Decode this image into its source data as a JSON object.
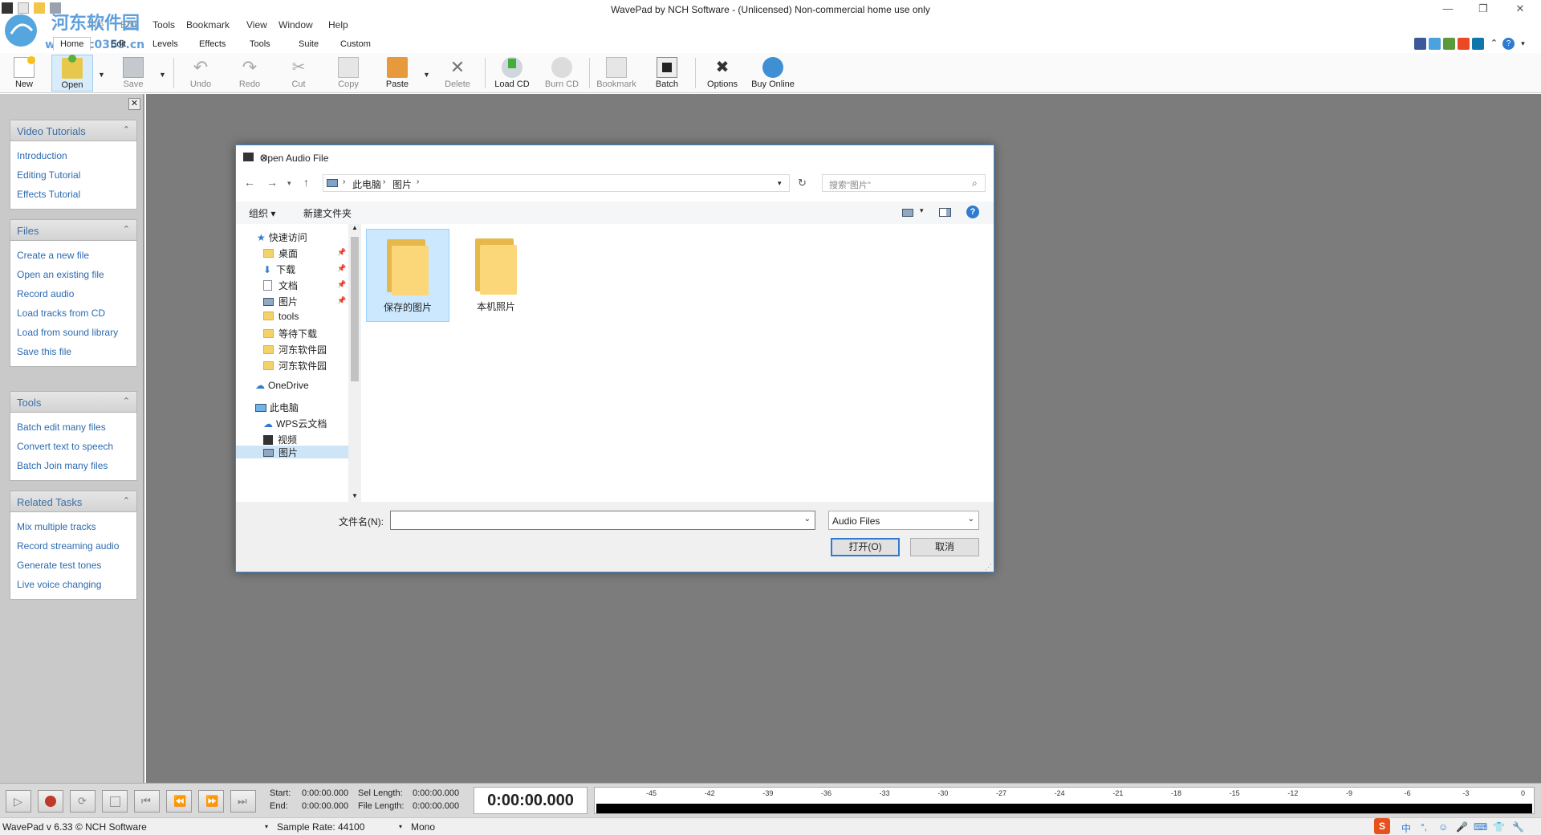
{
  "window": {
    "title": "WavePad by NCH Software - (Unlicensed) Non-commercial home use only",
    "minimize": "—",
    "restore": "❐",
    "close": "✕"
  },
  "menu": [
    "File",
    "Edit",
    "Tools",
    "Bookmark",
    "View",
    "Window",
    "Help"
  ],
  "watermark": {
    "line1": "河东软件园",
    "line2": "www.pc0359.cn"
  },
  "tabs": {
    "home": "Home",
    "edit": "Edit",
    "levels": "Levels",
    "effects": "Effects",
    "tools": "Tools",
    "suite": "Suite",
    "custom": "Custom"
  },
  "toolbar": {
    "new": "New",
    "open": "Open",
    "save": "Save",
    "undo": "Undo",
    "redo": "Redo",
    "cut": "Cut",
    "copy": "Copy",
    "paste": "Paste",
    "delete": "Delete",
    "load_cd": "Load CD",
    "burn_cd": "Burn CD",
    "bookmark": "Bookmark",
    "batch": "Batch",
    "options": "Options",
    "buy_online": "Buy Online"
  },
  "left_panels": {
    "video_tutorials": {
      "title": "Video Tutorials",
      "items": [
        "Introduction",
        "Editing Tutorial",
        "Effects Tutorial"
      ]
    },
    "files": {
      "title": "Files",
      "items": [
        "Create a new file",
        "Open an existing file",
        "Record audio",
        "Load tracks from CD",
        "Load from sound library",
        "Save this file"
      ]
    },
    "tools": {
      "title": "Tools",
      "items": [
        "Batch edit many files",
        "Convert text to speech",
        "Batch Join many files"
      ]
    },
    "related_tasks": {
      "title": "Related Tasks",
      "items": [
        "Mix multiple tracks",
        "Record streaming audio",
        "Generate test tones",
        "Live voice changing"
      ]
    }
  },
  "dialog": {
    "title": "Open Audio File",
    "breadcrumb": [
      "此电脑",
      "图片"
    ],
    "search_placeholder": "搜索\"图片\"",
    "organize": "组织 ▾",
    "new_folder": "新建文件夹",
    "nav": {
      "quick_access": "快速访问",
      "desktop": "桌面",
      "downloads": "下载",
      "documents": "文档",
      "pictures": "图片",
      "tools": "tools",
      "pending_downloads": "等待下载",
      "hedong1": "河东软件园",
      "hedong2": "河东软件园",
      "onedrive": "OneDrive",
      "this_pc": "此电脑",
      "wps_cloud": "WPS云文档",
      "videos": "视频",
      "pictures2": "图片"
    },
    "folders": [
      "保存的图片",
      "本机照片"
    ],
    "filename_label": "文件名(N):",
    "filename_value": "",
    "filetype": "Audio Files",
    "open_btn": "打开(O)",
    "cancel_btn": "取消"
  },
  "transport": {
    "start_label": "Start:",
    "start_value": "0:00:00.000",
    "end_label": "End:",
    "end_value": "0:00:00.000",
    "sel_label": "Sel Length:",
    "sel_value": "0:00:00.000",
    "file_label": "File Length:",
    "file_value": "0:00:00.000",
    "big_time": "0:00:00.000",
    "meter_ticks": [
      "-45",
      "-42",
      "-39",
      "-36",
      "-33",
      "-30",
      "-27",
      "-24",
      "-21",
      "-18",
      "-15",
      "-12",
      "-9",
      "-6",
      "-3",
      "0"
    ]
  },
  "status": {
    "version": "WavePad v 6.33 © NCH Software",
    "sample_rate": "Sample Rate: 44100",
    "channels": "Mono",
    "ime": "中"
  }
}
